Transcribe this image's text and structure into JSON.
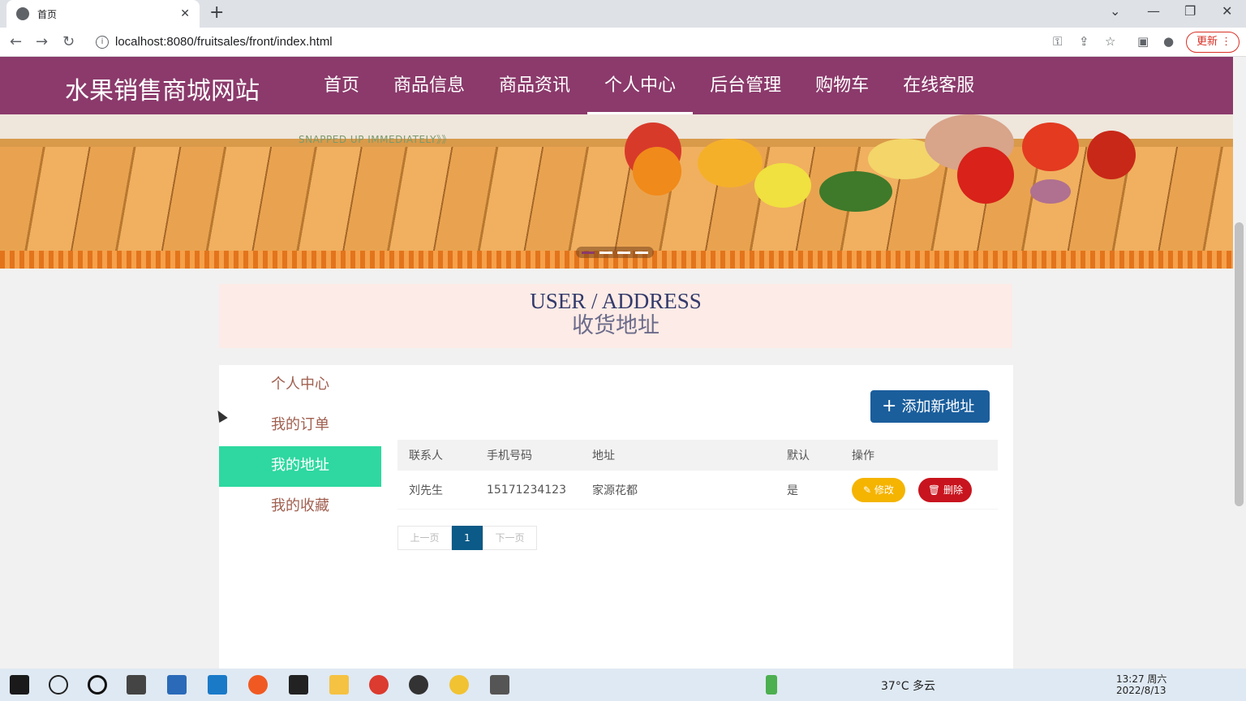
{
  "browser": {
    "tab_title": "首页",
    "url": "localhost:8080/fruitsales/front/index.html",
    "update_label": "更新"
  },
  "site": {
    "logo": "水果销售商城网站",
    "nav": [
      {
        "label": "首页",
        "active": false
      },
      {
        "label": "商品信息",
        "active": false
      },
      {
        "label": "商品资讯",
        "active": false
      },
      {
        "label": "个人中心",
        "active": true
      },
      {
        "label": "后台管理",
        "active": false
      },
      {
        "label": "购物车",
        "active": false
      },
      {
        "label": "在线客服",
        "active": false
      }
    ],
    "accent": "#8b3a6b"
  },
  "banner": {
    "caption": "SNAPPED UP IMMEDIATELY》》",
    "slides_count": 4,
    "active_slide": 1
  },
  "section": {
    "title_en": "USER / ADDRESS",
    "title_cn": "收货地址"
  },
  "sidebar": {
    "items": [
      {
        "label": "个人中心",
        "active": false
      },
      {
        "label": "我的订单",
        "active": false
      },
      {
        "label": "我的地址",
        "active": true
      },
      {
        "label": "我的收藏",
        "active": false
      }
    ]
  },
  "actions": {
    "add_label": "添加新地址"
  },
  "table": {
    "headers": [
      "联系人",
      "手机号码",
      "地址",
      "默认",
      "操作"
    ],
    "rows": [
      {
        "contact": "刘先生",
        "phone": "15171234123",
        "address": "家源花都",
        "default": "是",
        "edit_label": "修改",
        "delete_label": "删除"
      }
    ]
  },
  "pager": {
    "prev": "上一页",
    "current": "1",
    "next": "下一页"
  },
  "taskbar": {
    "weather": "37°C 多云",
    "time": "13:27 周六",
    "date": "2022/8/13"
  }
}
